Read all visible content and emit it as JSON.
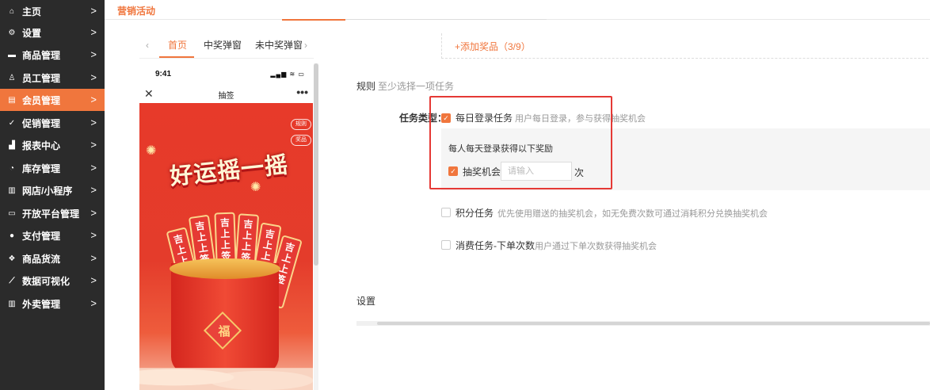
{
  "sidebar": {
    "active_color": "#f0763d",
    "items": [
      {
        "label": "主页",
        "icon": "home-icon"
      },
      {
        "label": "设置",
        "icon": "gear-icon"
      },
      {
        "label": "商品管理",
        "icon": "card-icon"
      },
      {
        "label": "员工管理",
        "icon": "user-icon"
      },
      {
        "label": "会员管理",
        "icon": "member-card-icon",
        "active": true
      },
      {
        "label": "促销管理",
        "icon": "check-circle-icon"
      },
      {
        "label": "报表中心",
        "icon": "bar-chart-icon"
      },
      {
        "label": "库存管理",
        "icon": "pie-chart-icon"
      },
      {
        "label": "网店/小程序",
        "icon": "shop-icon"
      },
      {
        "label": "开放平台管理",
        "icon": "monitor-icon"
      },
      {
        "label": "支付管理",
        "icon": "pay-icon"
      },
      {
        "label": "商品货流",
        "icon": "flow-icon"
      },
      {
        "label": "数据可视化",
        "icon": "line-chart-icon"
      },
      {
        "label": "外卖管理",
        "icon": "delivery-icon"
      }
    ]
  },
  "header": {
    "title": "营销活动"
  },
  "preview": {
    "tabs": [
      {
        "label": "首页",
        "active": true
      },
      {
        "label": "中奖弹窗"
      },
      {
        "label": "未中奖弹窗"
      }
    ],
    "status_time": "9:41",
    "status_icons": "▂▄▆ ≋ ▭",
    "page_title": "抽签",
    "side_buttons": [
      "规则",
      "奖品"
    ],
    "banner": "好运摇一摇",
    "lots": [
      "吉上上签",
      "吉上上签",
      "吉上上签",
      "吉上上签",
      "吉上上签",
      "吉上上签"
    ],
    "cup_char": "福"
  },
  "form": {
    "add_prize": "+添加奖品（3/9）",
    "rules_label": "规则",
    "rules_hint": "至少选择一项任务",
    "task_type_label": "任务类型：",
    "tasks": [
      {
        "label": "每日登录任务",
        "hint": "用户每日登录，参与获得抽奖机会",
        "checked": true
      },
      {
        "label": "积分任务",
        "hint": "优先使用赠送的抽奖机会，如无免费次数可通过消耗积分兑换抽奖机会",
        "checked": false
      },
      {
        "label": "消费任务-下单次数",
        "hint": "用户通过下单次数获得抽奖机会",
        "checked": false
      }
    ],
    "daily_desc": "每人每天登录获得以下奖励",
    "lottery_label": "抽奖机会",
    "times_placeholder": "请输入",
    "times_unit": "次",
    "settings_label": "设置"
  }
}
